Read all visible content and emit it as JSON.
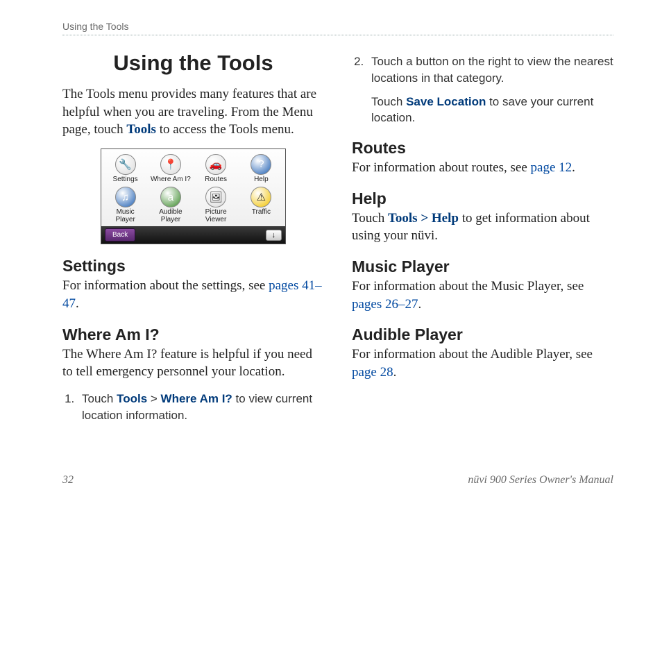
{
  "runningHeader": "Using the Tools",
  "title": "Using the Tools",
  "intro": {
    "pre": "The Tools menu provides many features that are helpful when you are traveling. From the Menu page, touch ",
    "link": "Tools",
    "post": " to access the Tools menu."
  },
  "device": {
    "apps": [
      {
        "name": "settings-icon",
        "glyph": "🔧",
        "bg": "#dcdcdc",
        "label": "Settings"
      },
      {
        "name": "where-am-i-icon",
        "glyph": "📍",
        "bg": "#dcdcdc",
        "label": "Where Am I?"
      },
      {
        "name": "routes-icon",
        "glyph": "🚗",
        "bg": "#dcdcdc",
        "label": "Routes"
      },
      {
        "name": "help-icon",
        "glyph": "?",
        "bg": "#1e5fb3",
        "fg": "#fff",
        "label": "Help"
      },
      {
        "name": "music-player-icon",
        "glyph": "♫",
        "bg": "#1e5fb3",
        "fg": "#fff",
        "label": "Music\nPlayer"
      },
      {
        "name": "audible-player-icon",
        "glyph": "a",
        "bg": "#3a8a2a",
        "fg": "#fff",
        "label": "Audible\nPlayer"
      },
      {
        "name": "picture-viewer-icon",
        "glyph": "🖼",
        "bg": "#dcdcdc",
        "label": "Picture\nViewer"
      },
      {
        "name": "traffic-icon",
        "glyph": "⚠",
        "bg": "#f2c200",
        "label": "Traffic"
      }
    ],
    "back": "Back",
    "down": "↓"
  },
  "settings": {
    "heading": "Settings",
    "textPre": "For information about the settings, see ",
    "link": "pages 41–47",
    "textPost": "."
  },
  "whereAmI": {
    "heading": "Where Am I?",
    "body": "The Where Am I? feature is helpful if you need to tell emergency personnel your location.",
    "step1": {
      "pre": "Touch ",
      "b1": "Tools",
      "mid": " > ",
      "b2": "Where Am I?",
      "post": " to view current location information."
    }
  },
  "step2": {
    "main": "Touch a button on the right to view the nearest locations in that category.",
    "subPre": "Touch ",
    "subBold": "Save Location",
    "subPost": " to save your current location."
  },
  "routes": {
    "heading": "Routes",
    "textPre": "For information about routes, see ",
    "link": "page 12",
    "textPost": "."
  },
  "help": {
    "heading": "Help",
    "pre": "Touch ",
    "bold": "Tools > Help",
    "post": " to get information about using your nüvi."
  },
  "music": {
    "heading": "Music Player",
    "pre": "For information about the Music Player, see ",
    "link": "pages 26–27",
    "post": "."
  },
  "audible": {
    "heading": "Audible Player",
    "pre": "For information about the Audible Player, see ",
    "link": "page 28",
    "post": "."
  },
  "footer": {
    "pageNum": "32",
    "docTitle": "nüvi 900 Series Owner's Manual"
  }
}
